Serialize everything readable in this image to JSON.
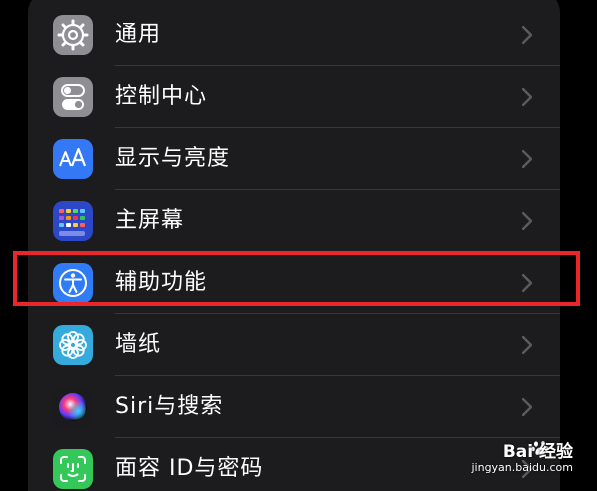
{
  "settings": {
    "items": [
      {
        "label": "通用",
        "icon": "gear-icon",
        "icon_color": "#8e8e93"
      },
      {
        "label": "控制中心",
        "icon": "toggle-switches-icon",
        "icon_color": "#8e8e93"
      },
      {
        "label": "显示与亮度",
        "icon": "text-size-aa-icon",
        "icon_color": "#3478f6"
      },
      {
        "label": "主屏幕",
        "icon": "home-screen-grid-icon",
        "icon_color": "#2c48c7"
      },
      {
        "label": "辅助功能",
        "icon": "accessibility-person-icon",
        "icon_color": "#2f7cf6"
      },
      {
        "label": "墙纸",
        "icon": "flower-icon",
        "icon_color": "#35aadc"
      },
      {
        "label": "Siri与搜索",
        "icon": "siri-orb-icon",
        "icon_color": "#1b1b1d"
      },
      {
        "label": "面容 ID与密码",
        "icon": "face-id-icon",
        "icon_color": "#34c759"
      }
    ],
    "highlighted_index": 4,
    "highlight_color": "#e8262b"
  },
  "watermark": {
    "top": "Bai 经验",
    "bottom": "jingyan.baidu.com"
  }
}
